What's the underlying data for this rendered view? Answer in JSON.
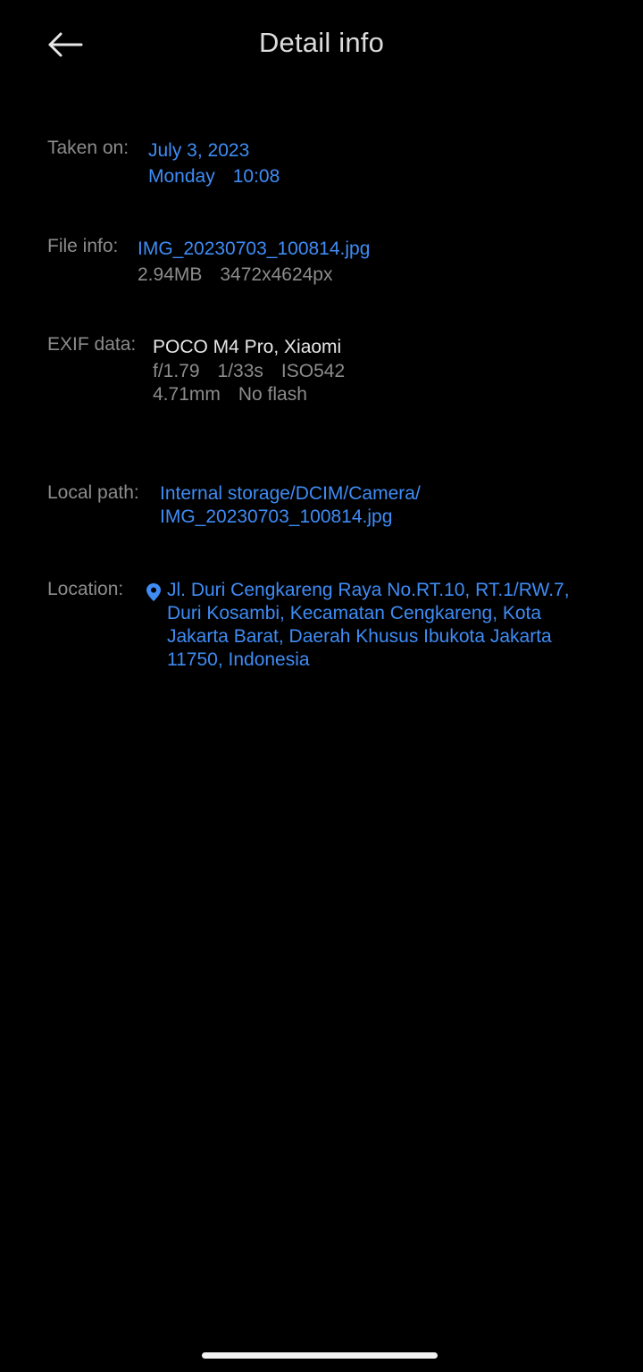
{
  "header": {
    "title": "Detail info",
    "back_icon": "arrow-left-icon"
  },
  "taken_on": {
    "label": "Taken on:",
    "date": "July 3, 2023",
    "weekday": "Monday",
    "time": "10:08"
  },
  "file_info": {
    "label": "File info:",
    "filename": "IMG_20230703_100814.jpg",
    "size": "2.94MB",
    "resolution": "3472x4624px"
  },
  "exif": {
    "label": "EXIF data:",
    "device": "POCO M4 Pro, Xiaomi",
    "aperture": "f/1.79",
    "shutter": "1/33s",
    "iso": "ISO542",
    "focal_length": "4.71mm",
    "flash": "No flash"
  },
  "local_path": {
    "label": "Local path:",
    "line1": "Internal storage/DCIM/Camera/",
    "line2": "IMG_20230703_100814.jpg"
  },
  "location": {
    "label": "Location:",
    "icon": "location-pin-icon",
    "line1": "Jl. Duri Cengkareng Raya No.RT.10, RT.1/RW.7,",
    "line2": "Duri Kosambi, Kecamatan Cengkareng, Kota",
    "line3": "Jakarta Barat, Daerah Khusus Ibukota Jakarta",
    "line4": "11750, Indonesia"
  },
  "colors": {
    "background": "#000000",
    "link": "#3f8cf5",
    "label": "#8c8c8c",
    "primary_text": "#e6e6e6"
  }
}
